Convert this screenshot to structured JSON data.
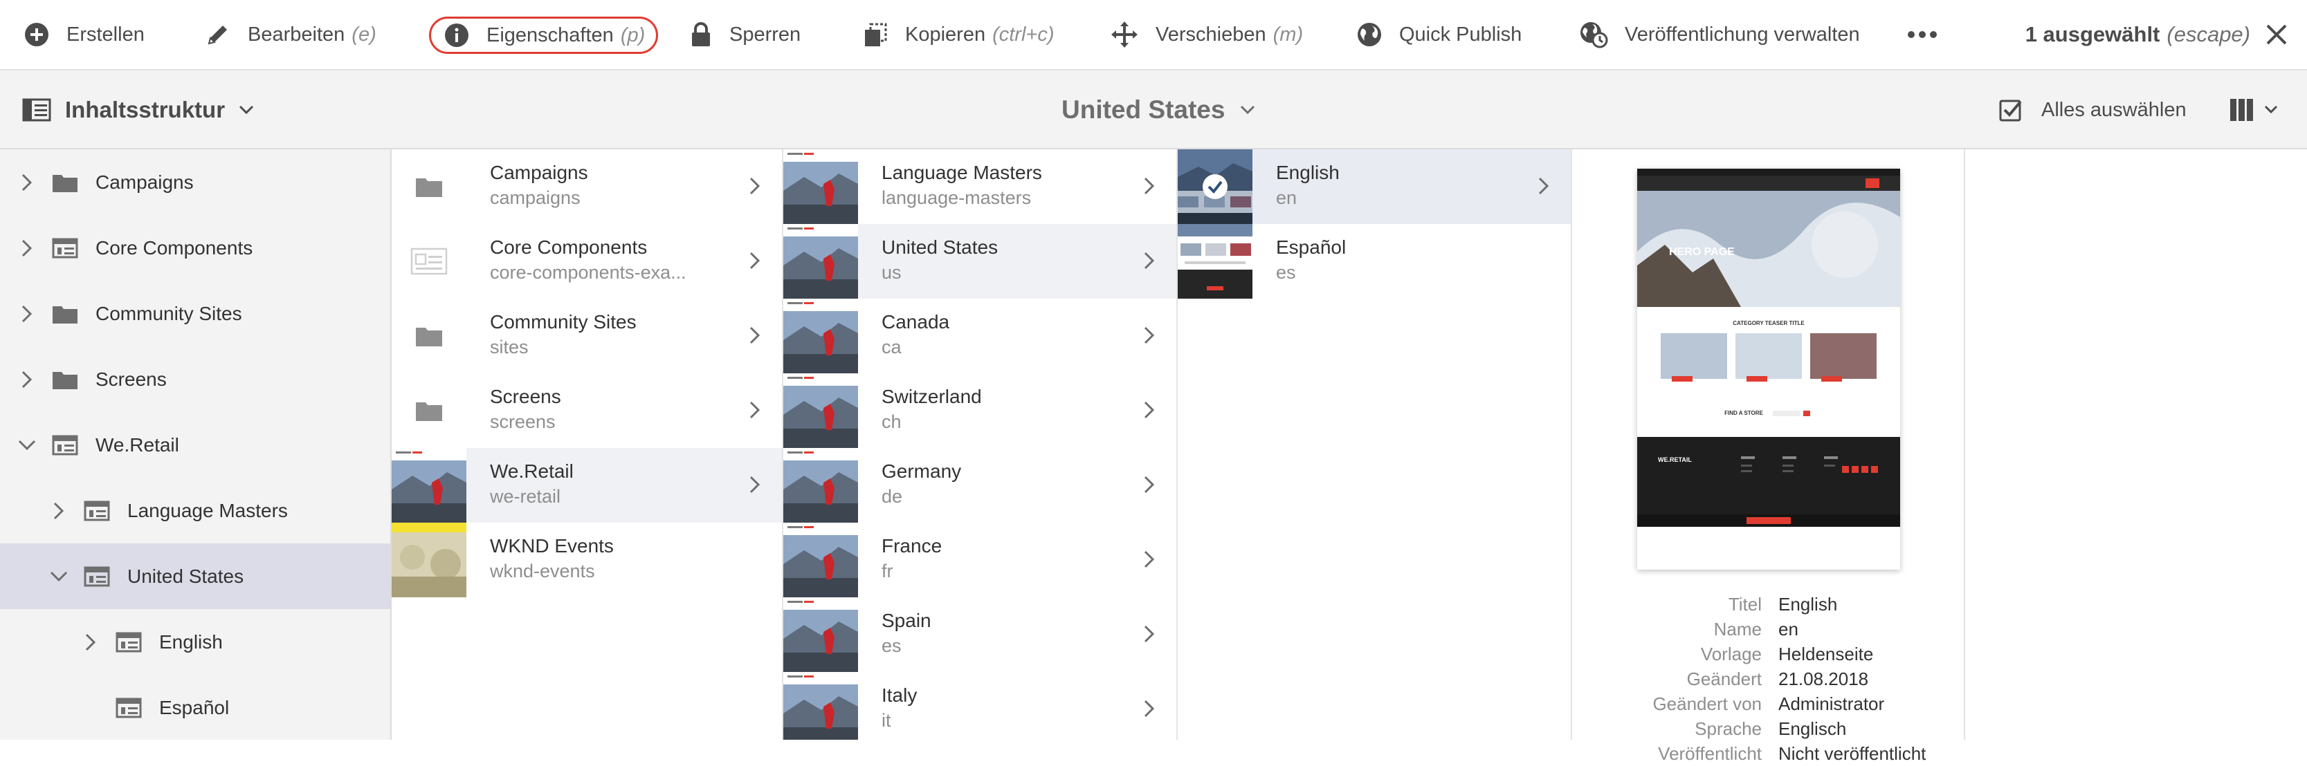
{
  "actionbar": {
    "create": "Erstellen",
    "edit": "Bearbeiten",
    "edit_hint": "(e)",
    "properties": "Eigenschaften",
    "properties_hint": "(p)",
    "lock": "Sperren",
    "copy": "Kopieren",
    "copy_hint": "(ctrl+c)",
    "move": "Verschieben",
    "move_hint": "(m)",
    "quick_publish": "Quick Publish",
    "manage_publication": "Veröffentlichung verwalten",
    "selected": "1 ausgewählt",
    "selected_hint": "(escape)"
  },
  "header": {
    "rail_label": "Inhaltsstruktur",
    "title": "United States",
    "select_all": "Alles auswählen"
  },
  "rail": {
    "items": [
      {
        "label": "Campaigns"
      },
      {
        "label": "Core Components"
      },
      {
        "label": "Community Sites"
      },
      {
        "label": "Screens"
      },
      {
        "label": "We.Retail"
      },
      {
        "label": "Language Masters"
      },
      {
        "label": "United States"
      },
      {
        "label": "English"
      },
      {
        "label": "Español"
      }
    ]
  },
  "col1": [
    {
      "title": "Campaigns",
      "name": "campaigns"
    },
    {
      "title": "Core Components",
      "name": "core-components-exa..."
    },
    {
      "title": "Community Sites",
      "name": "sites"
    },
    {
      "title": "Screens",
      "name": "screens"
    },
    {
      "title": "We.Retail",
      "name": "we-retail"
    },
    {
      "title": "WKND Events",
      "name": "wknd-events"
    }
  ],
  "col2": [
    {
      "title": "Language Masters",
      "name": "language-masters"
    },
    {
      "title": "United States",
      "name": "us"
    },
    {
      "title": "Canada",
      "name": "ca"
    },
    {
      "title": "Switzerland",
      "name": "ch"
    },
    {
      "title": "Germany",
      "name": "de"
    },
    {
      "title": "France",
      "name": "fr"
    },
    {
      "title": "Spain",
      "name": "es"
    },
    {
      "title": "Italy",
      "name": "it"
    }
  ],
  "col3": [
    {
      "title": "English",
      "name": "en"
    },
    {
      "title": "Español",
      "name": "es"
    }
  ],
  "preview": {
    "thumb_hero": "HERO PAGE",
    "thumb_teaser": "CATEGORY TEASER TITLE",
    "thumb_store": "FIND A STORE",
    "thumb_logo": "WE.RETAIL",
    "meta": [
      {
        "key": "Titel",
        "value": "English"
      },
      {
        "key": "Name",
        "value": "en"
      },
      {
        "key": "Vorlage",
        "value": "Heldenseite"
      },
      {
        "key": "Geändert",
        "value": "21.08.2018"
      },
      {
        "key": "Geändert von",
        "value": "Administrator"
      },
      {
        "key": "Sprache",
        "value": "Englisch"
      },
      {
        "key": "Veröffentlicht",
        "value": "Nicht veröffentlicht"
      }
    ]
  },
  "colors": {
    "accent_red": "#e03c31",
    "selected_rail": "#dcdce8",
    "check_blue": "#2680eb"
  }
}
